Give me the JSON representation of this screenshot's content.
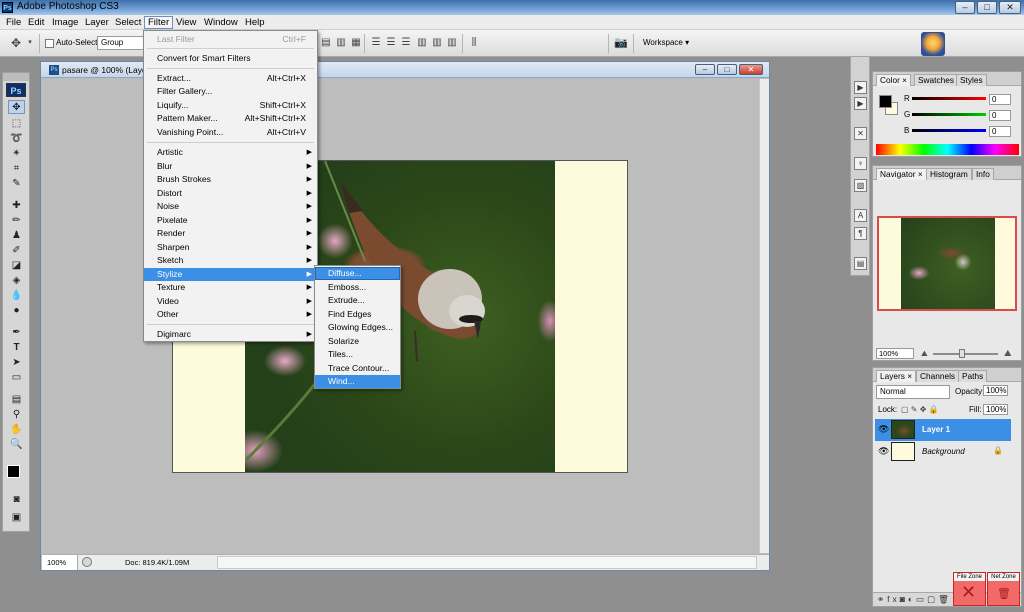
{
  "window": {
    "title": "Adobe Photoshop CS3",
    "app_icon": "Ps",
    "minimize": "–",
    "restore": "□",
    "close": "✕"
  },
  "menubar": [
    "File",
    "Edit",
    "Image",
    "Layer",
    "Select",
    "Filter",
    "View",
    "Window",
    "Help"
  ],
  "options": {
    "auto_select_label": "Auto-Select:",
    "auto_select_value": "Group",
    "workspace_label": "Workspace ▾"
  },
  "tools_logo": "Ps",
  "document": {
    "title": "pasare @ 100% (Layer",
    "zoom": "100%",
    "doc_info": "Doc: 819.4K/1.09M"
  },
  "filter_menu": {
    "last_filter": "Last Filter",
    "last_filter_shortcut": "Ctrl+F",
    "convert_smart": "Convert for Smart Filters",
    "items_top": [
      {
        "label": "Extract...",
        "shortcut": "Alt+Ctrl+X"
      },
      {
        "label": "Filter Gallery...",
        "shortcut": ""
      },
      {
        "label": "Liquify...",
        "shortcut": "Shift+Ctrl+X"
      },
      {
        "label": "Pattern Maker...",
        "shortcut": "Alt+Shift+Ctrl+X"
      },
      {
        "label": "Vanishing Point...",
        "shortcut": "Alt+Ctrl+V"
      }
    ],
    "submenus": [
      "Artistic",
      "Blur",
      "Brush Strokes",
      "Distort",
      "Noise",
      "Pixelate",
      "Render",
      "Sharpen",
      "Sketch",
      "Stylize",
      "Texture",
      "Video",
      "Other"
    ],
    "digimarc": "Digimarc"
  },
  "stylize_menu": [
    "Diffuse...",
    "Emboss...",
    "Extrude...",
    "Find Edges",
    "Glowing Edges...",
    "Solarize",
    "Tiles...",
    "Trace Contour...",
    "Wind..."
  ],
  "color_panel": {
    "tabs": [
      "Color",
      "Swatches",
      "Styles"
    ],
    "r": "0",
    "g": "0",
    "b": "0",
    "r_label": "R",
    "g_label": "G",
    "b_label": "B"
  },
  "navigator_panel": {
    "tabs": [
      "Navigator",
      "Histogram",
      "Info"
    ],
    "zoom": "100%"
  },
  "layers_panel": {
    "tabs": [
      "Layers",
      "Channels",
      "Paths"
    ],
    "blend_mode": "Normal",
    "opacity_label": "Opacity:",
    "opacity": "100%",
    "lock_label": "Lock:",
    "fill_label": "Fill:",
    "fill": "100%",
    "layers": [
      "Layer 1",
      "Background"
    ]
  },
  "zones": {
    "file_zone": "File Zone",
    "net_zone": "Net Zone"
  }
}
